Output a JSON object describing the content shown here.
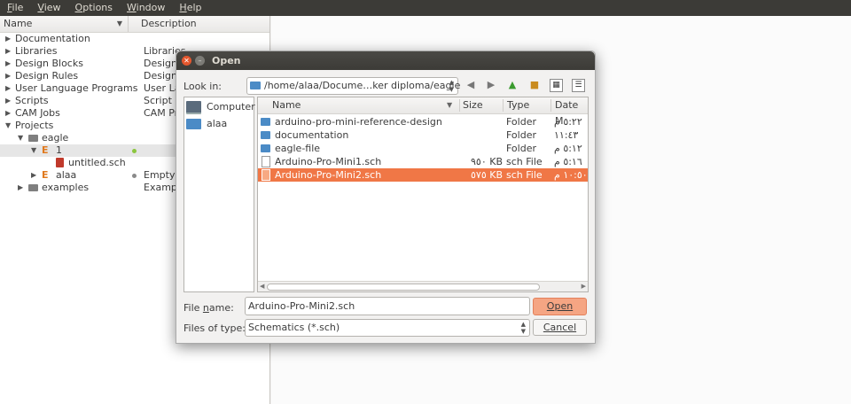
{
  "menubar": {
    "items": [
      {
        "accel": "F",
        "rest": "ile"
      },
      {
        "accel": "V",
        "rest": "iew"
      },
      {
        "accel": "O",
        "rest": "ptions"
      },
      {
        "accel": "W",
        "rest": "indow"
      },
      {
        "accel": "H",
        "rest": "elp"
      }
    ]
  },
  "tree": {
    "col_name": "Name",
    "col_desc": "Description",
    "rows": [
      {
        "label": "Documentation",
        "desc": ""
      },
      {
        "label": "Libraries",
        "desc": "Libraries"
      },
      {
        "label": "Design Blocks",
        "desc": "Design"
      },
      {
        "label": "Design Rules",
        "desc": "Design"
      },
      {
        "label": "User Language Programs",
        "desc": "User La"
      },
      {
        "label": "Scripts",
        "desc": "Script F"
      },
      {
        "label": "CAM Jobs",
        "desc": "CAM Pr"
      },
      {
        "label": "Projects",
        "desc": ""
      },
      {
        "label": "eagle",
        "desc": ""
      },
      {
        "label": "1",
        "desc": ""
      },
      {
        "label": "untitled.sch",
        "desc": ""
      },
      {
        "label": "alaa",
        "desc": "Empty P"
      },
      {
        "label": "examples",
        "desc": "Exampl"
      }
    ]
  },
  "dialog": {
    "title": "Open",
    "look_in_label": "Look in:",
    "path": "/home/alaa/Docume…ker diploma/eagle",
    "sidebar": [
      {
        "label": "Computer",
        "icon": "computer-icon"
      },
      {
        "label": "alaa",
        "icon": "home-folder-icon"
      }
    ],
    "columns": {
      "name": "Name",
      "size": "Size",
      "type": "Type",
      "date": "Date M"
    },
    "files": [
      {
        "name": "arduino-pro-mini-reference-design",
        "size": "",
        "type": "Folder",
        "date": "٥:٢٢ م",
        "kind": "folder"
      },
      {
        "name": "documentation",
        "size": "",
        "type": "Folder",
        "date": "١١:٤٣",
        "kind": "folder"
      },
      {
        "name": "eagle-file",
        "size": "",
        "type": "Folder",
        "date": "٥:١٢ م",
        "kind": "folder"
      },
      {
        "name": "Arduino-Pro-Mini1.sch",
        "size": "٩٥٠ KB",
        "type": "sch File",
        "date": "٥:١٦ م",
        "kind": "file"
      },
      {
        "name": "Arduino-Pro-Mini2.sch",
        "size": "٥٧٥ KB",
        "type": "sch File",
        "date": "١٠:٥٠ م",
        "kind": "file"
      }
    ],
    "selected_index": 4,
    "file_name_label": "File name:",
    "file_name_accel": "n",
    "file_name_value": "Arduino-Pro-Mini2.sch",
    "open_label": "Open",
    "file_type_label": "Files of type:",
    "file_type_value": "Schematics (*.sch)",
    "cancel_label": "Cancel",
    "colors": {
      "selection": "#f07746",
      "folder": "#4b8bc6",
      "titlebar": "#3c3b37"
    }
  }
}
